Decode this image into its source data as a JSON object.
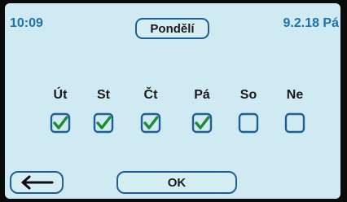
{
  "header": {
    "time": "10:09",
    "day_button_label": "Pondělí",
    "date": "9.2.18 Pá"
  },
  "days": [
    {
      "label": "Út",
      "checked": true
    },
    {
      "label": "St",
      "checked": true
    },
    {
      "label": "Čt",
      "checked": true
    },
    {
      "label": "Pá",
      "checked": true
    },
    {
      "label": "So",
      "checked": false
    },
    {
      "label": "Ne",
      "checked": false
    }
  ],
  "footer": {
    "ok_label": "OK",
    "back_icon": "back-arrow-icon"
  },
  "colors": {
    "screen_background": "#cfeaf3",
    "accent_blue": "#1b72ad",
    "checkbox_border": "#1e5f99",
    "checkmark_green": "#1f8a2e"
  }
}
